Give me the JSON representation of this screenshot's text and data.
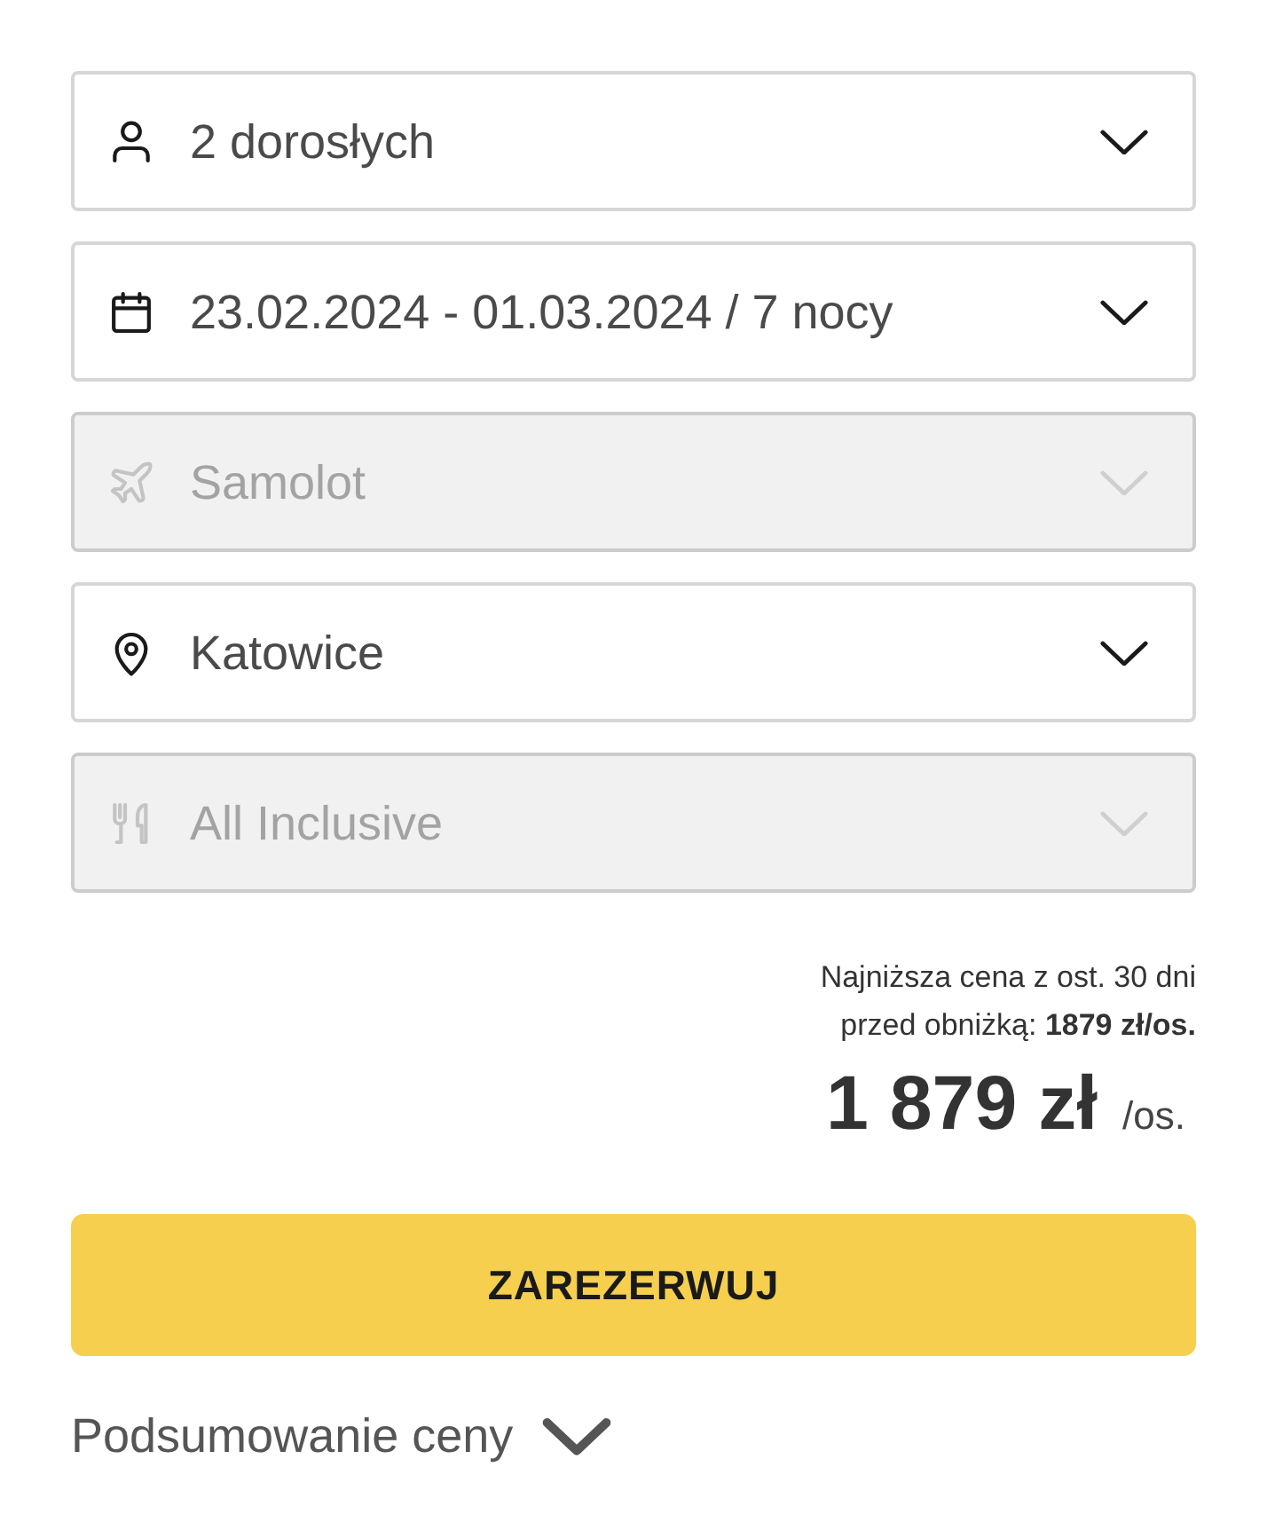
{
  "fields": [
    {
      "kind": "travellers",
      "value": "2 dorosłych",
      "disabled": false
    },
    {
      "kind": "dates",
      "value": "23.02.2024 - 01.03.2024 / 7 nocy",
      "disabled": false
    },
    {
      "kind": "transport",
      "value": "Samolot",
      "disabled": true
    },
    {
      "kind": "departure",
      "value": "Katowice",
      "disabled": false
    },
    {
      "kind": "board",
      "value": "All Inclusive",
      "disabled": true
    }
  ],
  "price_note": {
    "line_1": "Najniższa cena z ost. 30 dni",
    "line_2": "przed obniżką: **1879 zł/os.**"
  },
  "price": {
    "amount": "1 879 zł",
    "unit": "/os."
  },
  "book_button": {
    "label": "ZAREZERWUJ"
  },
  "price_summary": {
    "label": "Podsumowanie ceny",
    "expanded": false
  }
}
